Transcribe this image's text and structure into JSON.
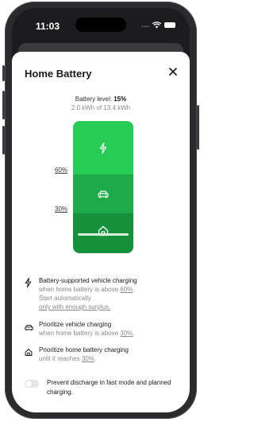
{
  "status_bar": {
    "time": "11:03",
    "signal": "...."
  },
  "sheet": {
    "title": "Home Battery",
    "close_label": "✕"
  },
  "battery": {
    "level_label": "Battery level: ",
    "level_value": "15%",
    "level_fraction": 0.15,
    "capacity_text": "2.0 kWh of 13.4 kWh",
    "marker_high": "60%",
    "marker_low": "30%"
  },
  "options": [
    {
      "icon": "lightning-icon",
      "title": "Battery-supported vehicle charging",
      "sub1_pre": "when home battery is above ",
      "sub1_val": "60%",
      "sub1_post": ".",
      "sub2": "Start automatically",
      "sub3": "only with enough surplus."
    },
    {
      "icon": "car-icon",
      "title": "Prioritize vehicle charging",
      "sub1_pre": "when home battery is above ",
      "sub1_val": "30%",
      "sub1_post": "."
    },
    {
      "icon": "house-icon",
      "title": "Prioritize home battery charging",
      "sub1_pre": "until it reaches ",
      "sub1_val": "30%",
      "sub1_post": "."
    }
  ],
  "toggle": {
    "label": "Prevent discharge in fast mode and planned charging.",
    "on": false
  },
  "colors": {
    "segment_top": "#27cc55",
    "segment_mid": "#1faa4a",
    "segment_bottom": "#17903c"
  }
}
